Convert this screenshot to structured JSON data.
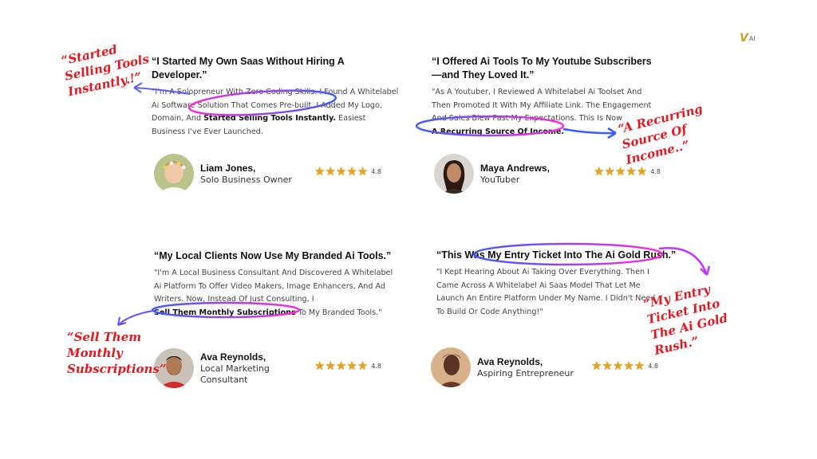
{
  "logo": {
    "mark": "V",
    "text": "AI"
  },
  "testimonials": [
    {
      "title": "“I Started My Own Saas Without Hiring A Developer.”",
      "body_before": "\"I'm A Solopreneur With Zero Coding Skills. I Found A Whitelabel Ai Software Solution That Comes Pre-built. I Added My Logo, Domain, And ",
      "highlight": "Started Selling Tools Instantly.",
      "body_after": " Easiest Business I've Ever Launched.",
      "name": "Liam Jones,",
      "role": "Solo Business Owner",
      "rating": "4.8"
    },
    {
      "title": "“I Offered Ai Tools To My Youtube Subscribers —and They Loved It.”",
      "body_before": "\"As A Youtuber, I Reviewed A Whitelabel Ai Toolset And Then Promoted It With My Affiliate Link. The Engagement And Sales Blew Past My Expectations. This Is Now ",
      "highlight": "A Recurring Source Of Income.",
      "body_after": "\"",
      "name": "Maya Andrews,",
      "role": "YouTuber",
      "rating": "4.8"
    },
    {
      "title": "“My Local Clients Now Use My Branded Ai Tools.”",
      "body_before": "\"I'm A Local Business Consultant And Discovered A Whitelabel Ai Platform To Offer Video Makers, Image Enhancers, And Ad Writers. Now, Instead Of Just Consulting, I ",
      "highlight": "Sell Them Monthly Subscriptions",
      "body_after": " To My Branded Tools.\"",
      "name": "Ava Reynolds,",
      "role": "Local Marketing Consultant",
      "rating": "4.8"
    },
    {
      "title_before": "“This Was ",
      "title_highlight": "My Entry Ticket Into The Ai Gold Rush.",
      "title_after": "”",
      "body": "\"I Kept Hearing About Ai Taking Over Everything. Then I Came Across A Whitelabel Ai Saas Model That Let Me Launch An Entire Platform Under My Name. I Didn't Need To Build Or Code Anything!\"",
      "name": "Ava Reynolds,",
      "role": "Aspiring Entrepreneur",
      "rating": "4.8"
    }
  ],
  "annotations": {
    "a1": "“Started Selling Tools Instantly.!”",
    "a2": "“A Recurring Source Of Income..”",
    "a3": "“Sell Them Monthly Subscriptions”",
    "a4": "“My Entry Ticket Into The Ai Gold Rush.”"
  },
  "stars": "★★★★★",
  "colors": {
    "star": "#e8a317",
    "annotation": "#e0181f",
    "circle_blue": "#3d5cff",
    "circle_pink": "#ff2bd6"
  }
}
